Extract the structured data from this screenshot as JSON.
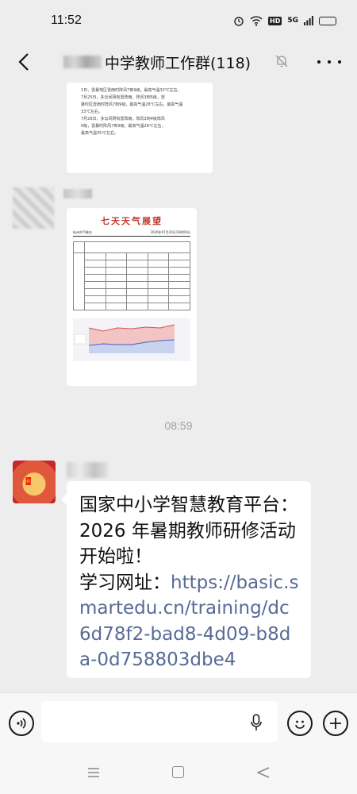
{
  "status_bar": {
    "time": "11:52",
    "network": "5G",
    "hd": "HD"
  },
  "header": {
    "title": "中学教师工作群(118)"
  },
  "messages": {
    "image1_lines": [
      "1日，雷暴地区雷雨时阵风7到9级，最高气温32℃左右。",
      "7月25日，多云间阴有雷阵雨，阵风3到5级，雷",
      "暴时区雷雨时阵风7到9级，最高气温28℃左右，最高气温",
      "33℃左右。",
      "7月26日，多云间阴有雷阵雨，阵风3到4级阵风",
      "6级，雷暴时阵风7到9级，最高气温28℃左右，",
      "最高气温35℃左右。"
    ],
    "image2": {
      "title": "七天天气展望",
      "left_sub": "杭州市气象台",
      "right_sub": "2026年07月20日16时00分"
    },
    "time_separator": "08:59",
    "text_message": {
      "line1": "国家中小学智慧教育平台：",
      "line2": "2026 年暑期教师研修活动",
      "line3": "开始啦！",
      "url_label": "学习网址：",
      "url": "https://basic.smartedu.cn/training/dc6d78f2-bad8-4d09-b8da-0d758803dbe4"
    }
  },
  "input": {
    "placeholder": ""
  },
  "colors": {
    "link": "#576b95",
    "background": "#ededed",
    "forecast_title": "#c0392b"
  }
}
